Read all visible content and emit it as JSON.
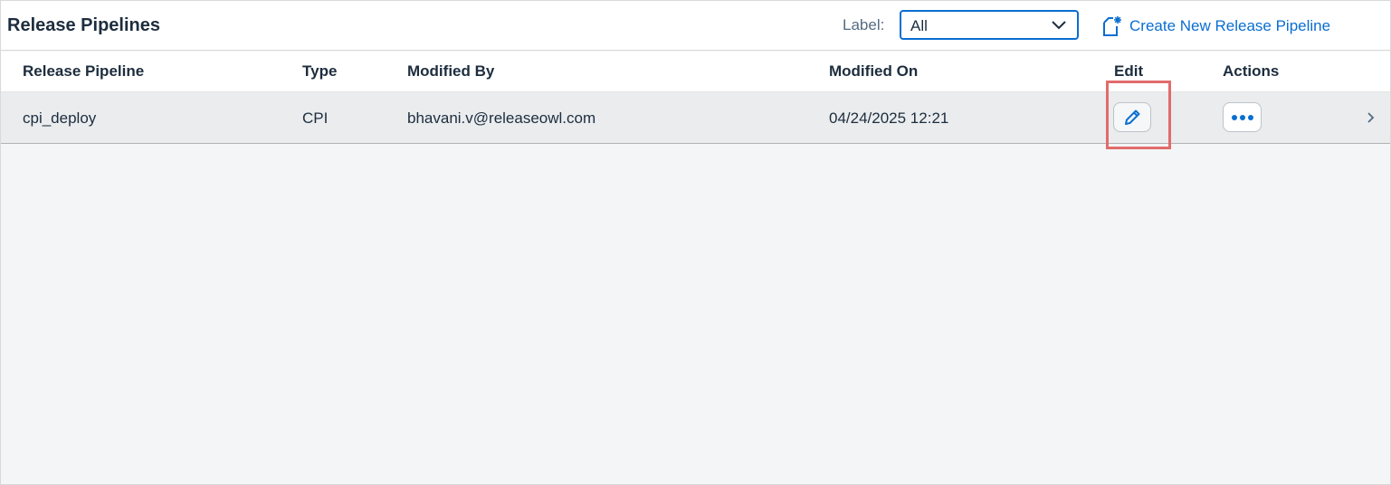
{
  "toolbar": {
    "title": "Release Pipelines",
    "label_text": "Label:",
    "label_select_value": "All",
    "create_button_label": "Create New Release Pipeline",
    "create_icon": "new-document-icon"
  },
  "table": {
    "columns": [
      "Release Pipeline",
      "Type",
      "Modified By",
      "Modified On",
      "Edit",
      "Actions"
    ],
    "rows": [
      {
        "release_pipeline": "cpi_deploy",
        "type": "CPI",
        "modified_by": "bhavani.v@releaseowl.com",
        "modified_on": "04/24/2025 12:21",
        "edit_icon": "pencil-icon",
        "actions_icon": "overflow-icon",
        "nav_icon": "chevron-right-icon"
      }
    ]
  },
  "colors": {
    "accent": "#0a6ed1",
    "highlight": "#e26b6b",
    "row_bg": "#eaecee",
    "page_bg": "#f4f5f6"
  }
}
